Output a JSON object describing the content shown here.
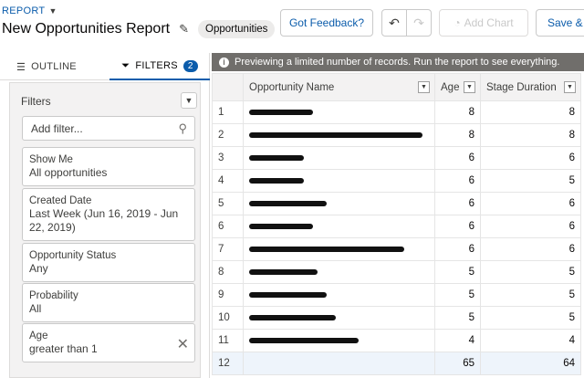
{
  "header": {
    "report_label": "REPORT",
    "title": "New Opportunities Report",
    "badge": "Opportunities",
    "buttons": {
      "feedback": "Got Feedback?",
      "add_chart": "Add Chart",
      "save": "Save & R"
    }
  },
  "left_panel": {
    "tabs": {
      "outline": "OUTLINE",
      "filters": "FILTERS",
      "filters_count": "2"
    },
    "filters_heading": "Filters",
    "add_filter_placeholder": "Add filter...",
    "cards": [
      {
        "label": "Show Me",
        "value": "All opportunities"
      },
      {
        "label": "Created Date",
        "value": "Last Week (Jun 16, 2019 - Jun 22, 2019)"
      },
      {
        "label": "Opportunity Status",
        "value": "Any"
      },
      {
        "label": "Probability",
        "value": "All"
      },
      {
        "label": "Age",
        "value": "greater than 1"
      }
    ]
  },
  "banner": "Previewing a limited number of records. Run the report to see everything.",
  "table": {
    "columns": [
      "Opportunity Name",
      "Age",
      "Stage Duration"
    ],
    "rows": [
      {
        "n": "1",
        "age": "8",
        "stage": "8"
      },
      {
        "n": "2",
        "age": "8",
        "stage": "8"
      },
      {
        "n": "3",
        "age": "6",
        "stage": "6"
      },
      {
        "n": "4",
        "age": "6",
        "stage": "5"
      },
      {
        "n": "5",
        "age": "6",
        "stage": "6"
      },
      {
        "n": "6",
        "age": "6",
        "stage": "6"
      },
      {
        "n": "7",
        "age": "6",
        "stage": "6"
      },
      {
        "n": "8",
        "age": "5",
        "stage": "5"
      },
      {
        "n": "9",
        "age": "5",
        "stage": "5"
      },
      {
        "n": "10",
        "age": "5",
        "stage": "5"
      },
      {
        "n": "11",
        "age": "4",
        "stage": "4"
      }
    ],
    "total": {
      "n": "12",
      "age": "65",
      "stage": "64"
    }
  },
  "icons": {
    "report_caret": "chevron-down-icon",
    "pencil": "pencil-icon",
    "undo": "undo-icon",
    "redo": "redo-icon",
    "outline": "list-icon",
    "filter": "funnel-icon",
    "info": "info-icon",
    "search": "search-icon",
    "clear": "close-icon"
  }
}
